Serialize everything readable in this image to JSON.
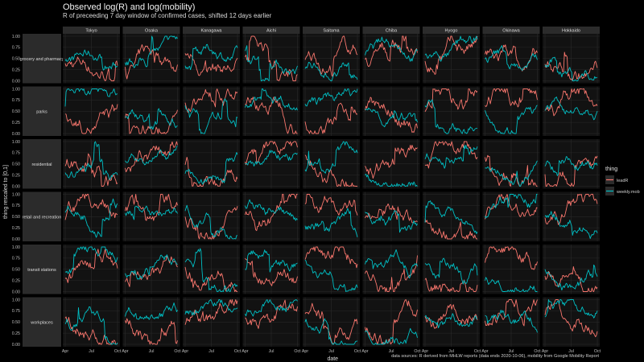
{
  "header": {
    "title": "Observed log(R) and log(mobility)",
    "subtitle": "R of preceeding 7 day window of confirmed cases, shifted 12 days earlier"
  },
  "caption": "data sources: R derived from MHLW reports (data ends 2020-10-06), mobility from Google Mobility Report",
  "colors": {
    "leadR": "#f8766d",
    "weekly_mob": "#00bfc4",
    "panel_bg": "#121212",
    "strip_bg": "#2b2b2b",
    "grid": "#2a2a2a"
  },
  "chart_data": {
    "type": "line",
    "facet_columns": [
      "Tokyo",
      "Osaka",
      "Kanagawa",
      "Aichi",
      "Saitama",
      "Chiba",
      "Hyogo",
      "Okinawa",
      "Hokkaido"
    ],
    "facet_rows": [
      "grocery and pharmacy",
      "parks",
      "residential",
      "retail and recreation",
      "transit stations",
      "workplaces"
    ],
    "xlabel": "date",
    "ylabel": "thing rescaled to [0,1]",
    "x_ticks": [
      "Apr",
      "Jul",
      "Oct"
    ],
    "y_ticks": [
      "0.00",
      "0.25",
      "0.50",
      "0.75",
      "1.00"
    ],
    "ylim": [
      0,
      1
    ],
    "legend": {
      "title": "thing",
      "position": "right",
      "entries": [
        "leadR",
        "weekly.mob"
      ]
    },
    "series": [
      {
        "name": "leadR",
        "color": "#f8766d"
      },
      {
        "name": "weekly.mob",
        "color": "#00bfc4"
      }
    ]
  }
}
